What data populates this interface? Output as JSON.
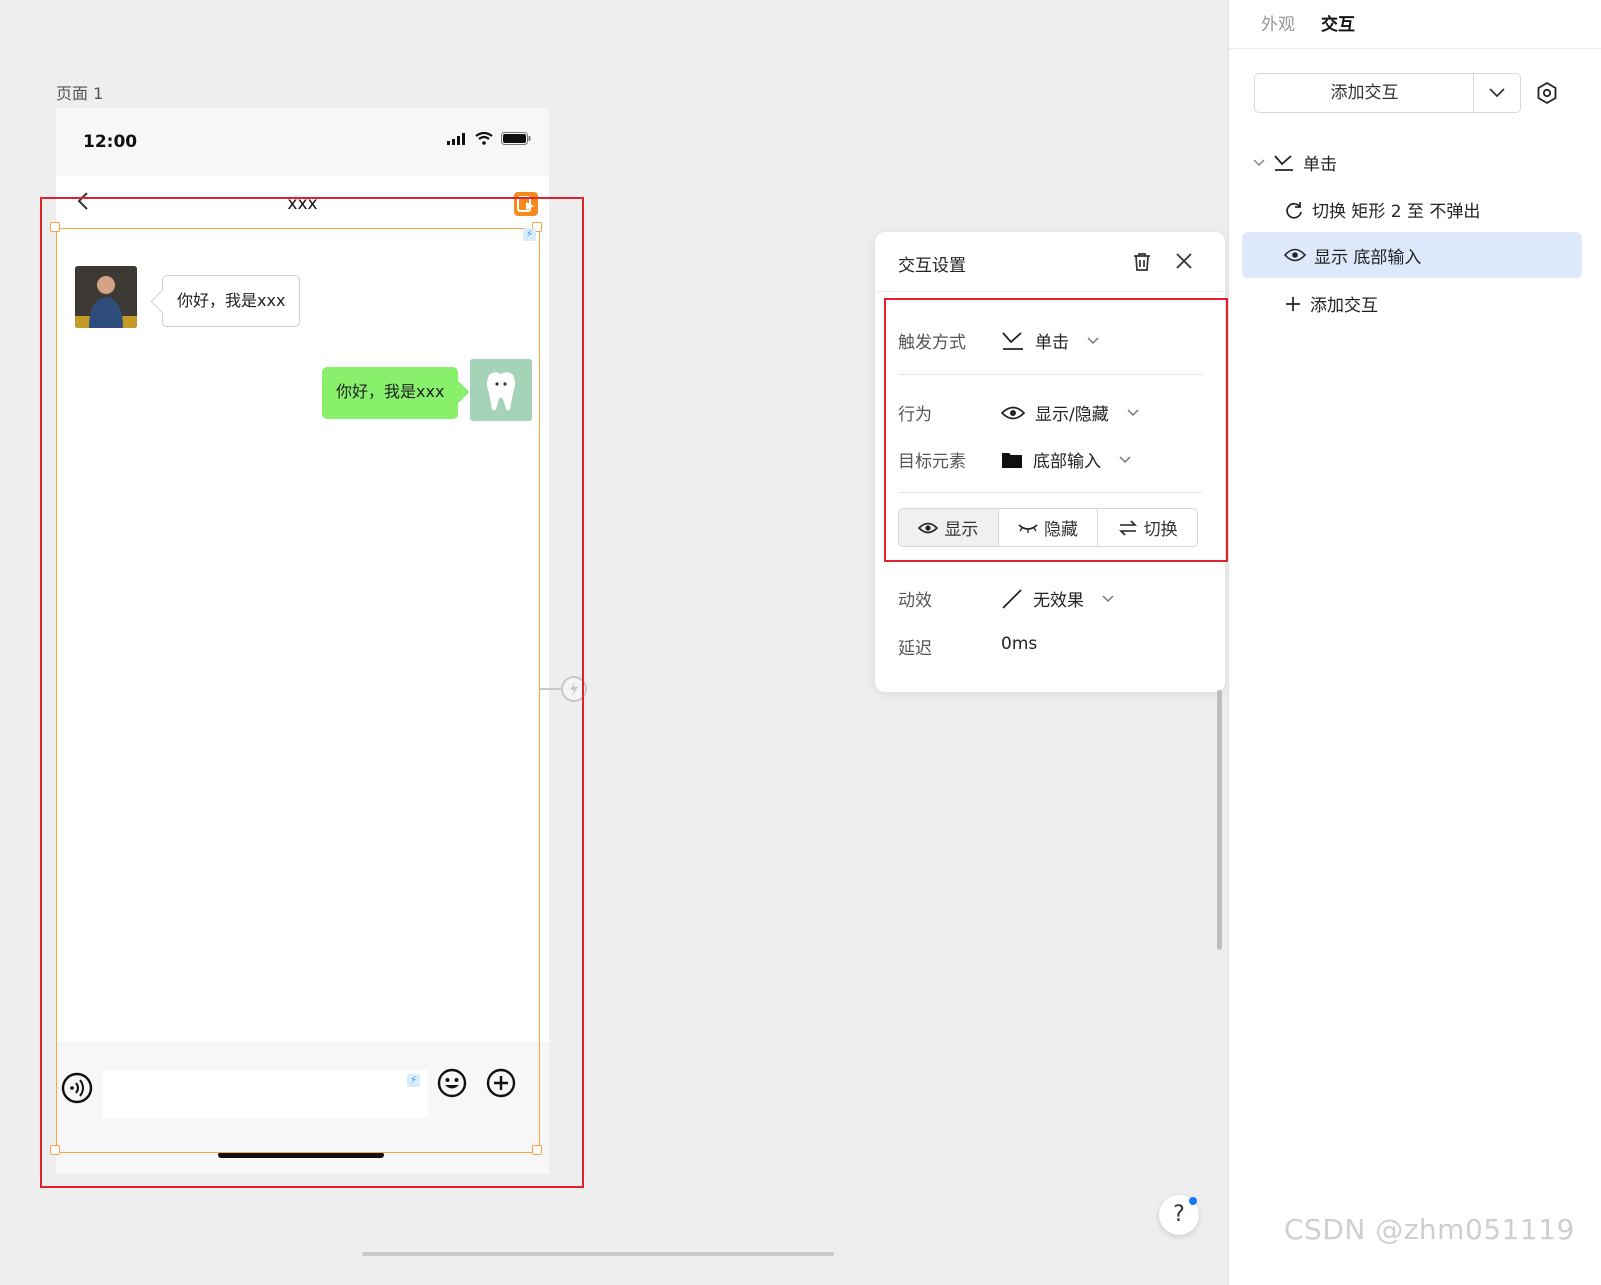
{
  "canvas": {
    "page_label": "页面 1",
    "phone": {
      "status_time": "12:00",
      "nav_title": "xxx",
      "messages": [
        {
          "side": "left",
          "text": "你好，我是xxx"
        },
        {
          "side": "right",
          "text": "你好，我是xxx"
        }
      ]
    }
  },
  "popup": {
    "title": "交互设置",
    "trigger_label": "触发方式",
    "trigger_value": "单击",
    "action_label": "行为",
    "action_value": "显示/隐藏",
    "target_label": "目标元素",
    "target_value": "底部输入",
    "segments": [
      {
        "label": "显示",
        "active": true
      },
      {
        "label": "隐藏",
        "active": false
      },
      {
        "label": "切换",
        "active": false
      }
    ],
    "animation_label": "动效",
    "animation_value": "无效果",
    "delay_label": "延迟",
    "delay_value": "0ms"
  },
  "right_panel": {
    "tabs": [
      "外观",
      "交互"
    ],
    "active_tab": "交互",
    "add_button": "添加交互",
    "tree": {
      "trigger": "单击",
      "items": [
        {
          "label": "切换 矩形 2 至 不弹出",
          "icon": "cycle-icon",
          "selected": false
        },
        {
          "label": "显示 底部输入",
          "icon": "eye-icon",
          "selected": true
        }
      ],
      "add_label": "添加交互"
    }
  },
  "help_label": "?",
  "watermark": "CSDN @zhm051119",
  "colors": {
    "selection": "#f5a646",
    "highlight_frame": "#e0222c",
    "selected_row": "#dde8fb",
    "bubble_green": "#88f06b"
  }
}
